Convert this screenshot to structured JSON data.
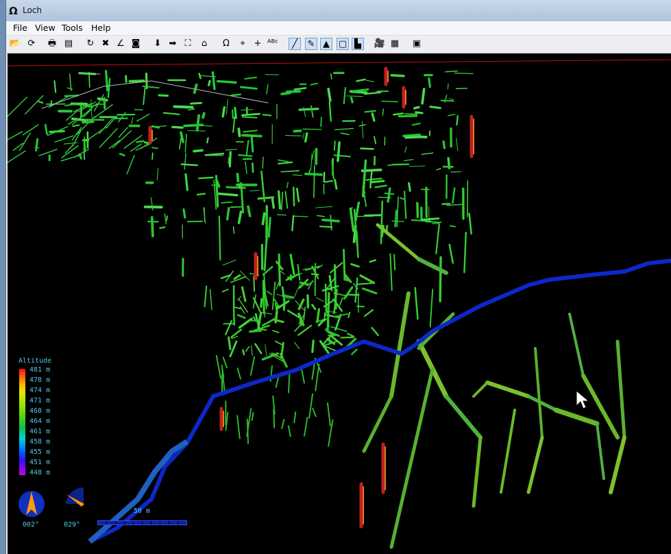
{
  "window": {
    "title": "Loch",
    "app_icon": "omega-icon"
  },
  "menu": [
    "File",
    "View",
    "Tools",
    "Help"
  ],
  "toolbar": {
    "buttons": [
      {
        "name": "open-icon",
        "glyph": "📂"
      },
      {
        "name": "reload-icon",
        "glyph": "⟳"
      },
      {
        "name": "print-icon",
        "glyph": "🖶"
      },
      {
        "name": "export-icon",
        "glyph": "▤"
      },
      {
        "name": "rotate-icon",
        "glyph": "↻"
      },
      {
        "name": "no-rotate-icon",
        "glyph": "✖"
      },
      {
        "name": "angle-icon",
        "glyph": "∠"
      },
      {
        "name": "stereo-glasses-icon",
        "glyph": "◙"
      },
      {
        "name": "view-down-icon",
        "glyph": "⬇"
      },
      {
        "name": "view-right-icon",
        "glyph": "➡"
      },
      {
        "name": "zoom-extents-icon",
        "glyph": "⛶"
      },
      {
        "name": "home-icon",
        "glyph": "⌂"
      },
      {
        "name": "omega-icon",
        "glyph": "Ω"
      },
      {
        "name": "target-icon",
        "glyph": "⌖"
      },
      {
        "name": "crosshair-icon",
        "glyph": "+"
      },
      {
        "name": "label-icon",
        "glyph": "ᴬᴮᶜ"
      },
      {
        "name": "centerline-icon",
        "glyph": "╱",
        "on": true
      },
      {
        "name": "walls-icon",
        "glyph": "✎",
        "on": true
      },
      {
        "name": "surface-icon",
        "glyph": "▲",
        "on": true
      },
      {
        "name": "bbox-icon",
        "glyph": "▢",
        "on": true
      },
      {
        "name": "indicators-icon",
        "glyph": "▙",
        "on": true
      },
      {
        "name": "camera-icon",
        "glyph": "🎥"
      },
      {
        "name": "details-icon",
        "glyph": "▦"
      },
      {
        "name": "fullscreen-icon",
        "glyph": "▣"
      }
    ]
  },
  "colors": {
    "passages": "#3fcf3f",
    "river": "#1030e0",
    "indicator_text": "#4fc9e6"
  },
  "legend": {
    "title": "Altitude",
    "levels": [
      "481 m",
      "478 m",
      "474 m",
      "471 m",
      "468 m",
      "464 m",
      "461 m",
      "458 m",
      "455 m",
      "451 m",
      "448 m"
    ]
  },
  "compass": {
    "value": "002°"
  },
  "tilt": {
    "value": "029°"
  },
  "scale": {
    "label": "50 m"
  }
}
